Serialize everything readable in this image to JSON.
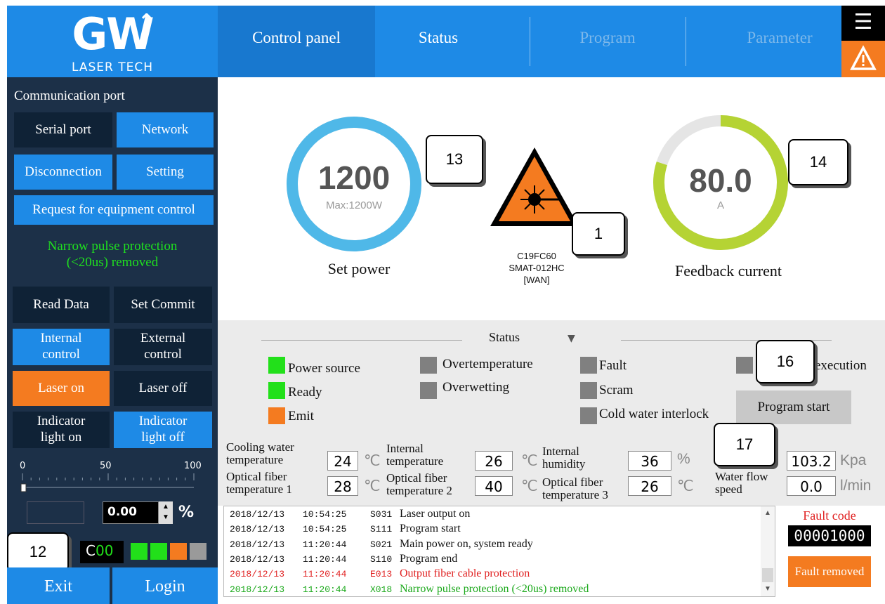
{
  "brand": {
    "logo_text": "GW",
    "logo_sub": "LASER TECH"
  },
  "tabs": [
    {
      "label": "Control panel",
      "state": "active"
    },
    {
      "label": "Status",
      "state": "normal"
    },
    {
      "label": "Program",
      "state": "disabled"
    },
    {
      "label": "Parameter",
      "state": "disabled"
    }
  ],
  "header_icons": {
    "menu": "list-icon",
    "alert": "warning-triangle-icon"
  },
  "sidebar": {
    "comm_title": "Communication port",
    "serial_port": "Serial port",
    "network": "Network",
    "disconnection": "Disconnection",
    "setting": "Setting",
    "request_control": "Request for equipment control",
    "notice_line1": "Narrow pulse protection",
    "notice_line2": "(<20us) removed",
    "read_data": "Read Data",
    "set_commit": "Set Commit",
    "internal_control_1": "Internal",
    "internal_control_2": "control",
    "external_control_1": "External",
    "external_control_2": "control",
    "laser_on": "Laser on",
    "laser_off": "Laser off",
    "indicator_on_1": "Indicator",
    "indicator_on_2": "light on",
    "indicator_off_1": "Indicator",
    "indicator_off_2": "light off",
    "slider_ticks": [
      "0",
      "50",
      "100"
    ],
    "slider_value": 0,
    "power_percent": "0.00",
    "power_unit": "%",
    "callout": "12",
    "coo_c": "C",
    "coo_num": "00",
    "indicators": [
      "#22e01a",
      "#22e01a",
      "#f47b20",
      "#9a9a9a"
    ],
    "exit": "Exit",
    "login": "Login"
  },
  "gauges": {
    "set_power": {
      "value": "1200",
      "sub": "Max:1200W",
      "title": "Set power",
      "fraction": 1.0,
      "color": "#4fb8e8"
    },
    "feedback_current": {
      "value": "80.0",
      "sub": "A",
      "title": "Feedback current",
      "fraction": 0.8,
      "color": "#b5d334"
    }
  },
  "model": {
    "line1": "C19FC60",
    "line2": "SMAT-012HC",
    "line3": "[WAN]"
  },
  "callouts": {
    "c13": "13",
    "c14": "14",
    "c1": "1",
    "c16": "16",
    "c17": "17"
  },
  "status": {
    "title": "Status",
    "items": {
      "power_source": "Power source",
      "ready": "Ready",
      "emit": "Emit",
      "overtemperature": "Overtemperature",
      "overwetting": "Overwetting",
      "fault": "Fault",
      "scram": "Scram",
      "cold_water_interlock": "Cold water interlock",
      "execution": "execution"
    },
    "program_start": "Program start"
  },
  "measurements": {
    "cooling_water_1": "Cooling water",
    "cooling_water_2": "temperature",
    "cooling_water_val": "24",
    "fiber1_1": "Optical fiber",
    "fiber1_2": "temperature 1",
    "fiber1_val": "28",
    "internal_temp_1": "Internal",
    "internal_temp_2": "temperature",
    "internal_temp_val": "26",
    "fiber2_1": "Optical fiber",
    "fiber2_2": "temperature 2",
    "fiber2_val": "40",
    "internal_hum_1": "Internal",
    "internal_hum_2": "humidity",
    "internal_hum_val": "36",
    "fiber3_1": "Optical fiber",
    "fiber3_2": "temperature 3",
    "fiber3_val": "26",
    "water_flow_1": "Water flow",
    "water_flow_2": "speed",
    "pressure_val": "103.2",
    "pressure_unit": "Kpa",
    "flow_val": "0.0",
    "flow_unit": "l/min",
    "celsius": "℃",
    "percent": "%"
  },
  "log": [
    {
      "date": "2018/12/13",
      "time": "10:54:25",
      "code": "S031",
      "msg": "Laser output on",
      "color": "#111111"
    },
    {
      "date": "2018/12/13",
      "time": "10:54:25",
      "code": "S111",
      "msg": "Program start",
      "color": "#111111"
    },
    {
      "date": "2018/12/13",
      "time": "11:20:44",
      "code": "S021",
      "msg": "Main power on, system ready",
      "color": "#111111"
    },
    {
      "date": "2018/12/13",
      "time": "11:20:44",
      "code": "S110",
      "msg": "Program end",
      "color": "#111111"
    },
    {
      "date": "2018/12/13",
      "time": "11:20:44",
      "code": "E013",
      "msg": "Output fiber cable protection",
      "color": "#e02020"
    },
    {
      "date": "2018/12/13",
      "time": "11:20:44",
      "code": "X018",
      "msg": "Narrow pulse protection (<20us) removed",
      "color": "#1aa81a"
    }
  ],
  "fault": {
    "label": "Fault code",
    "code": "00001000",
    "removed": "Fault removed"
  }
}
